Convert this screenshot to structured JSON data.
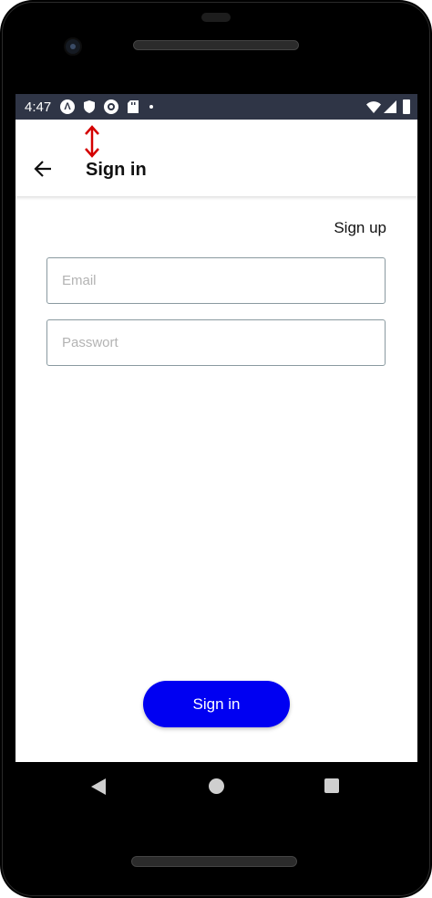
{
  "status_bar": {
    "time": "4:47",
    "notification_icons": [
      "app-a-icon",
      "shield-icon",
      "cast-icon",
      "sd-card-icon",
      "dot-icon"
    ],
    "system_icons": [
      "wifi-icon",
      "signal-icon",
      "battery-icon"
    ],
    "background": "#2f3546"
  },
  "app_bar": {
    "title": "Sign in",
    "back_icon": "arrow-left-icon",
    "marker_icon": "vertical-double-arrow-icon",
    "marker_color": "#d40000"
  },
  "auth": {
    "signup_link": "Sign up",
    "email_placeholder": "Email",
    "password_placeholder": "Passwort",
    "submit_label": "Sign in",
    "submit_color": "#0000f2"
  },
  "nav_bar": {
    "back_icon": "triangle-back-icon",
    "home_icon": "circle-home-icon",
    "recents_icon": "square-recents-icon"
  }
}
